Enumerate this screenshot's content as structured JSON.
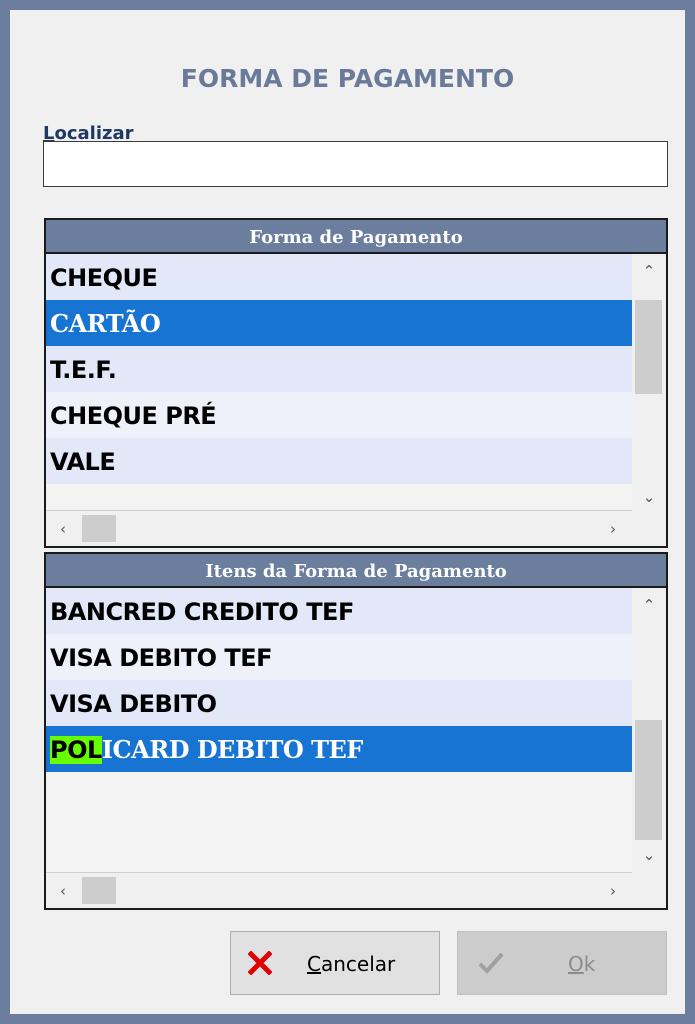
{
  "dialog": {
    "title": "FORMA DE PAGAMENTO",
    "search": {
      "label_accel": "L",
      "label_rest": "ocalizar",
      "value": ""
    }
  },
  "grid1": {
    "header": "Forma de Pagamento",
    "rows": [
      "CHEQUE",
      "CARTÃO",
      "T.E.F.",
      "CHEQUE PRÉ",
      "VALE"
    ],
    "selected_index": 1
  },
  "grid2": {
    "header": "Itens da Forma de Pagamento",
    "rows": [
      "BANCRED CREDITO TEF",
      "VISA DEBITO TEF",
      "VISA DEBITO"
    ],
    "selected_row": {
      "highlight": "POL",
      "rest": "ICARD DEBITO TEF"
    }
  },
  "buttons": {
    "cancel": {
      "accel": "C",
      "rest": "ancelar",
      "icon": "close-icon",
      "icon_color": "#e00000"
    },
    "ok": {
      "accel": "O",
      "rest": "k",
      "icon": "check-icon",
      "enabled": false
    }
  },
  "colors": {
    "header_bg": "#6b7e9e",
    "selection": "#1874d2",
    "search_highlight": "#66ff00",
    "title": "#6a7a99"
  }
}
